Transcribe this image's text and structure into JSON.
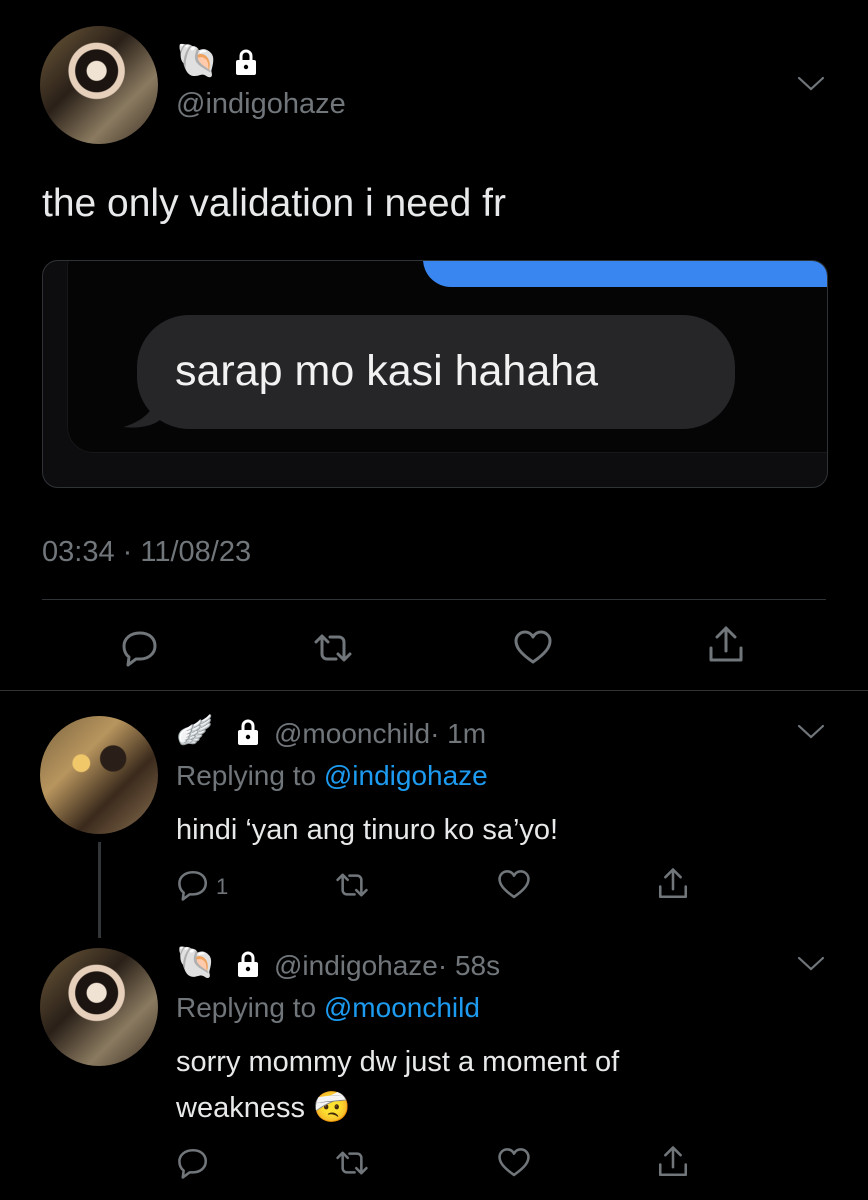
{
  "main_tweet": {
    "badge_emoji": "🐚",
    "handle": "@indigohaze",
    "text": "the only validation i need fr",
    "image": {
      "message_text": "sarap mo kasi hahaha"
    },
    "timestamp": "03:34 · 11/08/23"
  },
  "replies": [
    {
      "badge_emoji": "🪽",
      "handle": "@moonchild",
      "time": "· 1m",
      "replying_prefix": "Replying to ",
      "replying_to": "@indigohaze",
      "text": "hindi ‘yan ang tinuro ko sa’yo!",
      "reply_count": "1"
    },
    {
      "badge_emoji": "🐚",
      "handle": "@indigohaze",
      "time": "· 58s",
      "replying_prefix": "Replying to ",
      "replying_to": "@moonchild",
      "text_line1": "sorry mommy dw just a moment of",
      "text_line2": "weakness",
      "emoji": "🤕"
    }
  ],
  "colors": {
    "background": "#000000",
    "text": "#e7e9ea",
    "muted": "#71767b",
    "accent": "#1d9bf0",
    "message_bubble": "#262628"
  }
}
